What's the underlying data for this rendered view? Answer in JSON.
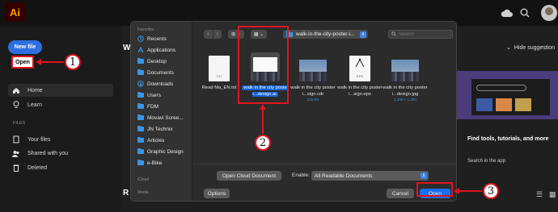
{
  "app": {
    "logo": "Ai",
    "icons": [
      "cloud-icon",
      "search-icon",
      "help-icon",
      "avatar"
    ]
  },
  "leftnav": {
    "new_file": "New file",
    "open": "Open",
    "items": [
      {
        "label": "Home",
        "icon": "home-icon"
      },
      {
        "label": "Learn",
        "icon": "bulb-icon"
      }
    ],
    "section_title": "FILES",
    "files_items": [
      {
        "label": "Your files",
        "icon": "file-icon"
      },
      {
        "label": "Shared with you",
        "icon": "people-icon"
      },
      {
        "label": "Deleted",
        "icon": "trash-icon"
      }
    ]
  },
  "main": {
    "heading_partial": "W",
    "recent_partial": "R"
  },
  "right_panel": {
    "hide": "Hide suggestion",
    "find": "Find tools, tutorials, and more",
    "search_app": "Search in the app"
  },
  "dialog": {
    "sidebar": {
      "favorites_header": "Favorites",
      "favorites": [
        {
          "label": "Recents",
          "icon": "clock-icon"
        },
        {
          "label": "Applications",
          "icon": "apps-icon"
        },
        {
          "label": "Desktop",
          "icon": "folder-icon"
        },
        {
          "label": "Documents",
          "icon": "folder-icon"
        },
        {
          "label": "Downloads",
          "icon": "download-icon"
        },
        {
          "label": "Users",
          "icon": "folder-icon"
        },
        {
          "label": "FDM",
          "icon": "folder-icon"
        },
        {
          "label": "Movavi Scree...",
          "icon": "folder-icon"
        },
        {
          "label": "JN Technix",
          "icon": "folder-icon"
        },
        {
          "label": "Articles",
          "icon": "folder-icon"
        },
        {
          "label": "Graphic Design",
          "icon": "folder-icon"
        },
        {
          "label": "e-Bike",
          "icon": "folder-icon"
        }
      ],
      "icloud_header": "iCloud",
      "media_header": "Media"
    },
    "toolbar": {
      "back": "‹",
      "forward": "›",
      "view_grid": "⊞ ⌄",
      "view_group": "▦ ⌄",
      "path": "walk-in-the-city-poster-i...",
      "search_placeholder": "Search"
    },
    "files": [
      {
        "name": "Read Ma_EN.txt",
        "ext": "TXT",
        "kind": "doc"
      },
      {
        "name": "walk in the city poster i...design.ai",
        "kind": "photo",
        "selected": true
      },
      {
        "name": "walk in the city poster i...sign.cdr",
        "size": "215 KB",
        "kind": "photo"
      },
      {
        "name": "walk in the city poster i...sign.eps",
        "ext": "EPS",
        "kind": "eps"
      },
      {
        "name": "walk in the city poster i...design.jpg",
        "size": "1,200 × 1,200",
        "kind": "photo"
      }
    ],
    "bottom": {
      "open_cloud": "Open Cloud Document",
      "enable_label": "Enable:",
      "enable_value": "All Readable Documents",
      "options": "Options",
      "cancel": "Cancel",
      "open": "Open"
    }
  },
  "callouts": [
    "1",
    "2",
    "3"
  ],
  "colors": {
    "annotation_red": "#e0141e",
    "accent_blue": "#1a6ef0",
    "selection_blue": "#1463d6"
  }
}
